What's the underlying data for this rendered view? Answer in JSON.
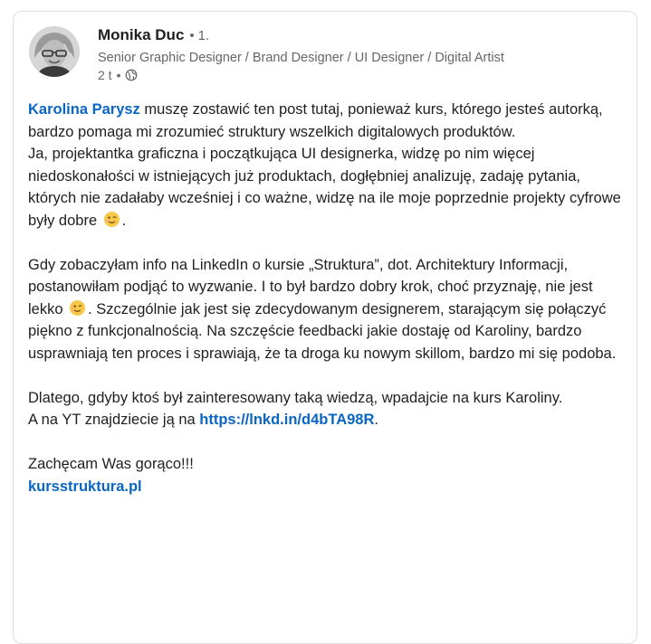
{
  "author": {
    "name": "Monika Duc",
    "degree": "1.",
    "headline": "Senior Graphic Designer / Brand Designer / UI Designer / Digital Artist",
    "time": "2 t"
  },
  "post": {
    "mention": "Karolina Parysz",
    "p1_rest": " muszę zostawić ten post tutaj, ponieważ kurs, którego jesteś autorką, bardzo pomaga mi zrozumieć struktury wszelkich digitalowych produktów.",
    "p2": "Ja, projektantka graficzna i początkująca UI designerka, widzę po nim więcej niedoskonałości w istniejących już produktach, dogłębniej analizuję, zadaję pytania, których nie zadałaby wcześniej i co ważne, widzę na ile moje poprzednie projekty cyfrowe były dobre",
    "p2_end": ".",
    "p3_a": "Gdy zobaczyłam info na LinkedIn o kursie „Struktura”, dot. Architektury Informacji, postanowiłam podjąć to wyzwanie. I to był bardzo dobry krok, choć przyznaję, nie jest lekko",
    "p3_b": ". Szczególnie jak jest się zdecydowanym designerem, starającym się połączyć piękno z funkcjonalnością. Na szczęście feedbacki jakie dostaję od Karoliny, bardzo usprawniają ten proces i sprawiają, że ta droga ku nowym skillom, bardzo mi się podoba.",
    "p4": "Dlatego, gdyby ktoś był zainteresowany taką wiedzą, wpadajcie na kurs Karoliny.",
    "p5_pre": "A na YT znajdziecie ją na ",
    "p5_link": "https://lnkd.in/d4bTA98R",
    "p5_post": ".",
    "p6": "Zachęcam Was gorąco!!!",
    "p7_link": "kursstruktura.pl"
  },
  "icons": {
    "wink": "wink-emoji-icon",
    "globe": "globe-icon",
    "avatar": "avatar"
  },
  "colors": {
    "link": "#0a66c2",
    "muted": "#666666",
    "text": "#1f1f1f"
  }
}
